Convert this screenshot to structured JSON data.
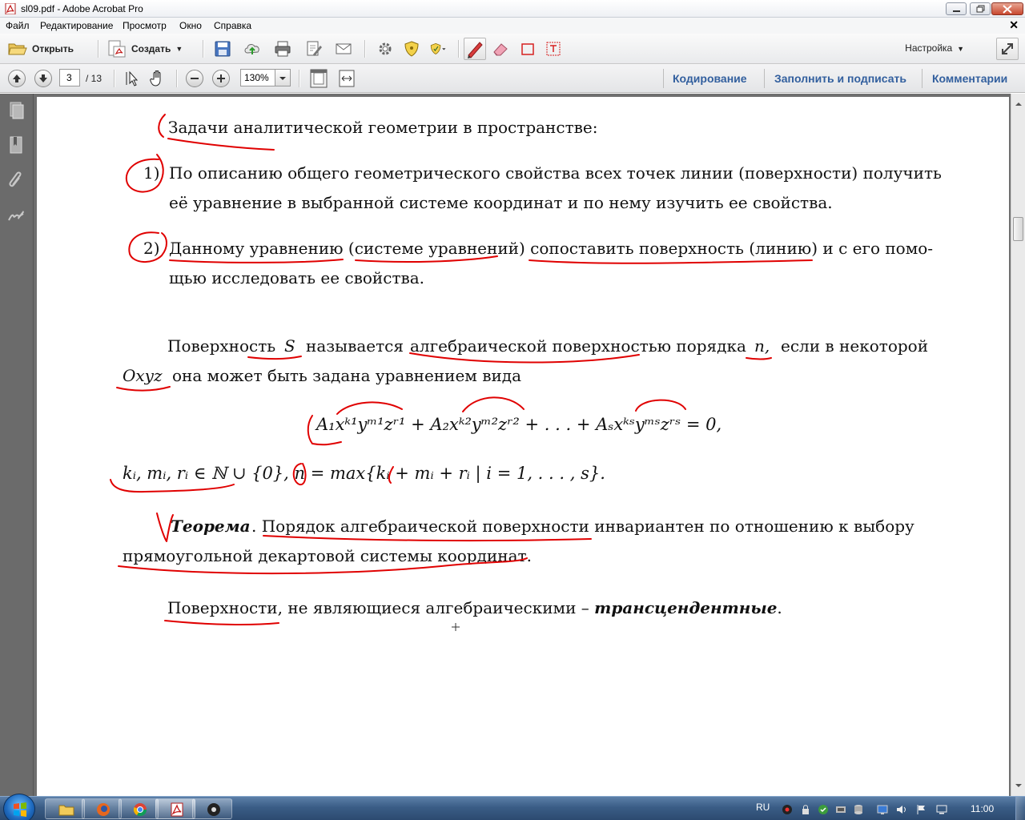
{
  "window": {
    "title": "sl09.pdf - Adobe Acrobat Pro"
  },
  "menu": [
    "Файл",
    "Редактирование",
    "Просмотр",
    "Окно",
    "Справка"
  ],
  "toolbar": {
    "open_label": "Открыть",
    "create_label": "Создать",
    "customize_label": "Настройка"
  },
  "nav": {
    "page_current": "3",
    "page_total": "/ 13",
    "zoom": "130%"
  },
  "right_tabs": [
    "Кодирование",
    "Заполнить и подписать",
    "Комментарии"
  ],
  "document": {
    "line1": "Задачи аналитической геометрии в пространстве:",
    "item1_num": "1)",
    "item1_line1": "По описанию общего геометрического свойства всех точек линии (поверхности) получить",
    "item1_line2": "её уравнение в выбранной системе координат и по нему изучить ее свойства.",
    "item2_num": "2)",
    "item2_line1": "Данному уравнению (системе уравнений) сопоставить поверхность (линию) и с его помо-",
    "item2_line2": "щью исследовать ее свойства.",
    "def_line1_a": "Поверхность",
    "def_line1_S": "S",
    "def_line1_b": "называется",
    "def_line1_c": "алгебраической поверхностью порядка",
    "def_line1_n": "n,",
    "def_line1_d": "если в некоторой",
    "def_line2_Oxyz": "Oxyz",
    "def_line2_b": "она может быть задана уравнением вида",
    "formula": "A₁xᵏ¹yᵐ¹zʳ¹ + A₂xᵏ²yᵐ²zʳ² + . . . + Aₛxᵏˢyᵐˢzʳˢ = 0,",
    "condition": "kᵢ, mᵢ, rᵢ ∈ ℕ ∪ {0}, n = max{kᵢ + mᵢ + rᵢ | i = 1, . . . , s}.",
    "theorem_title": "Теорема",
    "theorem_line1": ". Порядок алгебраической поверхности инвариантен по отношению к выбору",
    "theorem_line2": "прямоугольной декартовой системы координат.",
    "trans_a": "Поверхности, не являющиеся алгебраическими –",
    "trans_b": "трансцендентные",
    "trans_c": "."
  },
  "taskbar": {
    "language": "RU",
    "clock": "11:00"
  },
  "colors": {
    "ink": "#e00000",
    "tab_text": "#325f9e",
    "nav_pane": "#6b6b6b",
    "taskbar": "#3a5d86"
  }
}
